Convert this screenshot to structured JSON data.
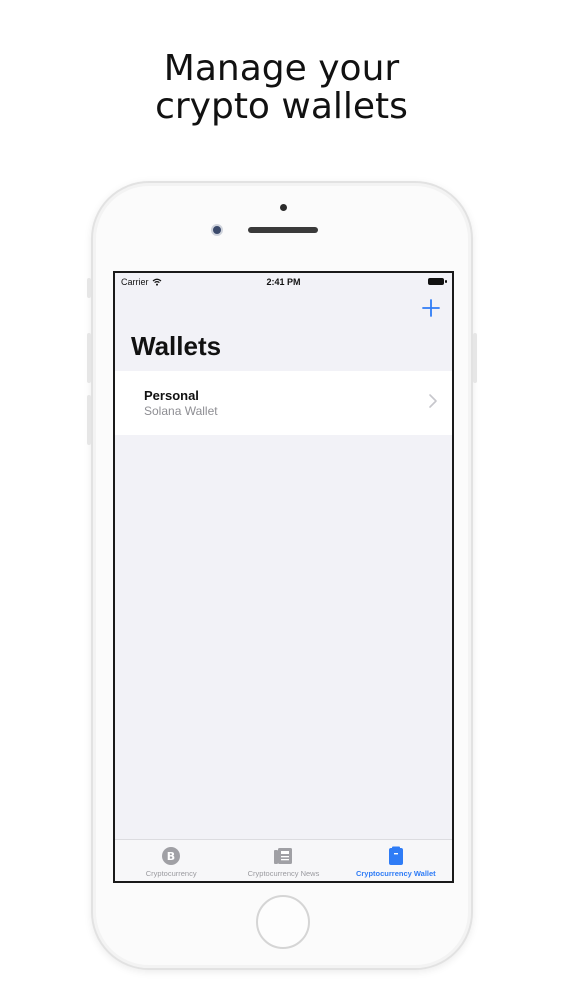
{
  "headline": {
    "line1": "Manage your",
    "line2": "crypto wallets"
  },
  "status_bar": {
    "carrier": "Carrier",
    "time": "2:41 PM"
  },
  "nav": {
    "title": "Wallets",
    "add_icon": "plus-icon"
  },
  "wallets": [
    {
      "name": "Personal",
      "type": "Solana Wallet"
    }
  ],
  "tab_bar": {
    "tabs": [
      {
        "label": "Cryptocurrency",
        "icon": "bitcoin-icon",
        "active": false
      },
      {
        "label": "Cryptocurrency News",
        "icon": "newspaper-icon",
        "active": false
      },
      {
        "label": "Cryptocurrency Wallet",
        "icon": "wallet-icon",
        "active": true
      }
    ]
  },
  "colors": {
    "accent": "#2f7cf6",
    "inactive": "#9a9a9f",
    "background": "#f2f2f7"
  }
}
